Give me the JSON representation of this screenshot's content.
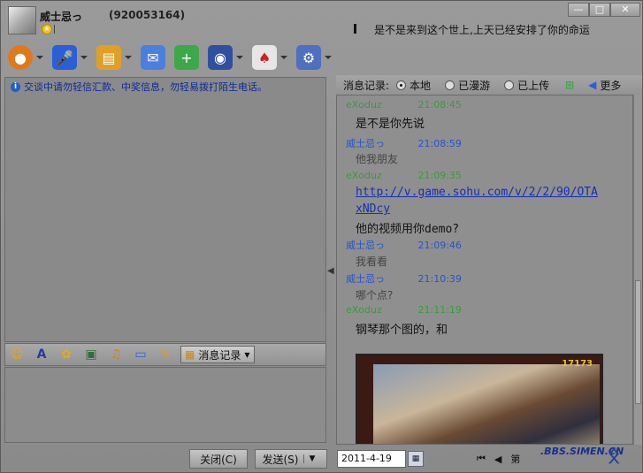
{
  "header": {
    "username": "威士忌っ",
    "user_id": "(920053164)",
    "signature": "是不是来到这个世上,上天已经安排了你的命运"
  },
  "window_controls": {
    "minimize": "—",
    "maximize": "□",
    "close": "✕"
  },
  "toolbar": {
    "items": [
      {
        "name": "video-call",
        "icon": "webcam-icon",
        "color": "#e07a18"
      },
      {
        "name": "voice-call",
        "icon": "microphone-icon",
        "color": "#2a5fd8"
      },
      {
        "name": "send-file",
        "icon": "folder-icon",
        "color": "#e0a024"
      },
      {
        "name": "email",
        "icon": "mail-icon",
        "color": "#4a7fe0"
      },
      {
        "name": "add-app",
        "icon": "add-app-icon",
        "color": "#3ca84a"
      },
      {
        "name": "remote-assist",
        "icon": "remote-icon",
        "color": "#2f4f9f"
      },
      {
        "name": "game",
        "icon": "cards-icon",
        "color": "#e6e6e6"
      },
      {
        "name": "settings",
        "icon": "gear-icon",
        "color": "#4f6fbf"
      }
    ]
  },
  "notice": "交谈中请勿轻信汇款、中奖信息，勿轻易拨打陌生电话。",
  "edit_toolbar": {
    "message_record_label": "消息记录"
  },
  "buttons": {
    "close": "关闭(C)",
    "send": "发送(S)"
  },
  "history": {
    "title": "消息记录:",
    "options": [
      "本地",
      "已漫游",
      "已上传"
    ],
    "selected": "本地",
    "more": "更多",
    "messages": [
      {
        "sender": "eXoduz",
        "time": "21:08:45",
        "text": "是不是你先说",
        "kind": "peer"
      },
      {
        "sender": "威士忌っ",
        "time": "21:08:59",
        "text": "他我朋友",
        "kind": "self"
      },
      {
        "sender": "eXoduz",
        "time": "21:09:35",
        "link_line1": "http://v.game.sohu.com/v/2/2/90/OTA",
        "link_line2": "xNDcy",
        "text": "他的视频用你demo?",
        "kind": "peer"
      },
      {
        "sender": "威士忌っ",
        "time": "21:09:46",
        "text": "我看看",
        "kind": "self"
      },
      {
        "sender": "威士忌っ",
        "time": "21:10:39",
        "text": "哪个点?",
        "kind": "self"
      },
      {
        "sender": "eXoduz",
        "time": "21:11:19",
        "text": "钢琴那个图的，和",
        "kind": "peer"
      }
    ],
    "video_logo": "17173",
    "date": "2011-4-19",
    "page_label": "第"
  },
  "colors": {
    "peer_name": "#3c9a3c",
    "self_name": "#2255cc",
    "time": "#2255cc"
  },
  "watermark": ".BBS.SIMEN.CN"
}
